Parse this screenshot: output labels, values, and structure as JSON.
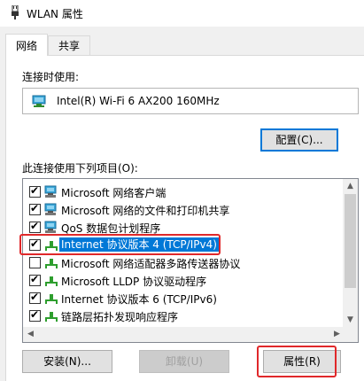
{
  "window": {
    "title": "WLAN 属性",
    "icon": "network-adapter-icon"
  },
  "tabs": [
    {
      "label": "网络",
      "active": true
    },
    {
      "label": "共享",
      "active": false
    }
  ],
  "connect_using": {
    "label": "连接时使用:",
    "adapter_name": "Intel(R) Wi-Fi 6 AX200 160MHz",
    "configure_button": "配置(C)..."
  },
  "items_section": {
    "label": "此连接使用下列项目(O):",
    "items": [
      {
        "label": "Microsoft 网络客户端",
        "checked": true,
        "icon": "network-client-icon"
      },
      {
        "label": "Microsoft 网络的文件和打印机共享",
        "checked": true,
        "icon": "network-client-icon"
      },
      {
        "label": "QoS 数据包计划程序",
        "checked": true,
        "icon": "qos-icon"
      },
      {
        "label": "Internet 协议版本 4 (TCP/IPv4)",
        "checked": true,
        "icon": "protocol-icon",
        "selected": true
      },
      {
        "label": "Microsoft 网络适配器多路传送器协议",
        "checked": false,
        "icon": "protocol-icon"
      },
      {
        "label": "Microsoft LLDP 协议驱动程序",
        "checked": true,
        "icon": "protocol-icon"
      },
      {
        "label": "Internet 协议版本 6 (TCP/IPv6)",
        "checked": true,
        "icon": "protocol-icon"
      },
      {
        "label": "链路层拓扑发现响应程序",
        "checked": true,
        "icon": "protocol-icon"
      }
    ]
  },
  "buttons": {
    "install": "安装(N)...",
    "uninstall": "卸载(U)",
    "properties": "属性(R)"
  },
  "colors": {
    "selection": "#0078d7",
    "highlight_annotation": "#e0282a"
  }
}
